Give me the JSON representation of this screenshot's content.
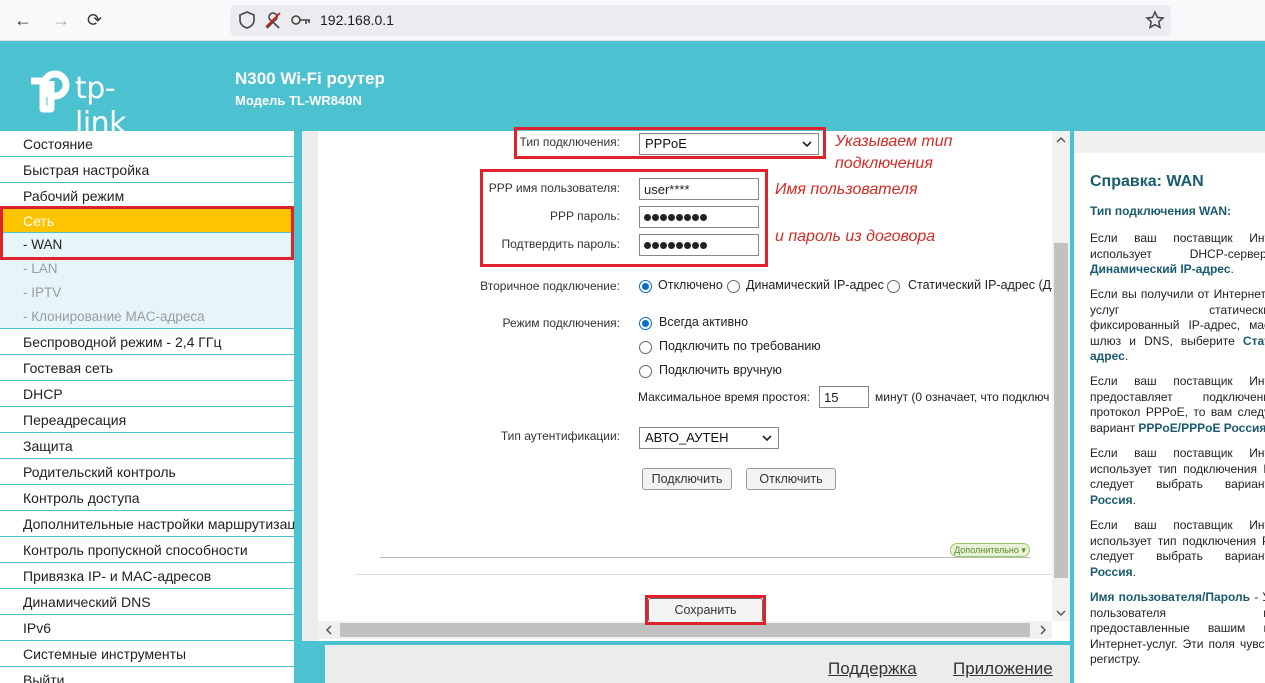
{
  "browser": {
    "back": "←",
    "forward": "→",
    "reload": "⟳",
    "url": "192.168.0.1"
  },
  "header": {
    "logo_text": "tp-link",
    "title": "N300 Wi-Fi роутер",
    "model": "Модель TL-WR840N"
  },
  "sidebar": {
    "items_top": [
      "Состояние",
      "Быстрая настройка",
      "Рабочий режим"
    ],
    "selected": "Сеть",
    "sub_items": [
      "- WAN",
      "- LAN",
      "- IPTV",
      "- Клонирование MAC-адреса"
    ],
    "items_bottom": [
      "Беспроводной режим - 2,4 ГГц",
      "Гостевая сеть",
      "DHCP",
      "Переадресация",
      "Защита",
      "Родительский контроль",
      "Контроль доступа",
      "Дополнительные настройки маршрутизации",
      "Контроль пропускной способности",
      "Привязка IP- и MAC-адресов",
      "Динамический DNS",
      "IPv6",
      "Системные инструменты",
      "Выйти"
    ]
  },
  "form": {
    "conn_type_label": "Тип подключения:",
    "conn_type_value": "PPPoE",
    "user_label": "PPP имя пользователя:",
    "user_value": "user****",
    "pass_label": "PPP пароль:",
    "confirm_label": "Подтвердить пароль:",
    "secondary_label": "Вторичное подключение:",
    "secondary_options": [
      "Отключено",
      "Динамический IP-адрес",
      "Статический IP-адрес  (Дл"
    ],
    "mode_label": "Режим подключения:",
    "mode_options": [
      "Всегда активно",
      "Подключить по требованию",
      "Подключить вручную"
    ],
    "idle_label": "Максимальное время простоя:",
    "idle_value": "15",
    "idle_suffix": "минут (0 означает, что подключ",
    "auth_label": "Тип аутентификации:",
    "auth_value": "АВТО_АУТЕН",
    "connect_btn": "Подключить",
    "disconnect_btn": "Отключить",
    "advanced_btn": "Дополнительно ▾",
    "save_btn": "Сохранить"
  },
  "annotations": {
    "note1_line1": "Указываем тип",
    "note1_line2": "подключения",
    "note2": "Имя пользователя",
    "note3": "и пароль из договора"
  },
  "footer": {
    "support": "Поддержка",
    "app": "Приложение"
  },
  "help": {
    "title": "Справка: WAN",
    "subtitle": "Тип подключения WAN:",
    "p1": "Если ваш поставщик Инт использует DHCP-сервер, ",
    "p1_link": "Динамический IP-адрес",
    "p2": "Если вы получили от Интернет-услуг статически фиксированный IP-адрес, мас шлюз и DNS, выберите ",
    "p2_link": "Стат адрес",
    "p3": "Если ваш поставщик Инт предоставляет подключени протокол PPPoE, то вам следу вариант ",
    "p3_link": "PPPoE/PPPoE Россия",
    "p4": "Если ваш поставщик Инт использует тип подключения L следует выбрать вариант ",
    "p4_link": "Россия",
    "p5": "Если ваш поставщик Инт использует тип подключения P следует выбрать вариант ",
    "p5_link": "Россия",
    "p6_head": "Имя пользователя/Пароль",
    "p6": " - У пользователя и предоставленные вашим п Интернет-услуг. Эти поля чувст регистру."
  }
}
